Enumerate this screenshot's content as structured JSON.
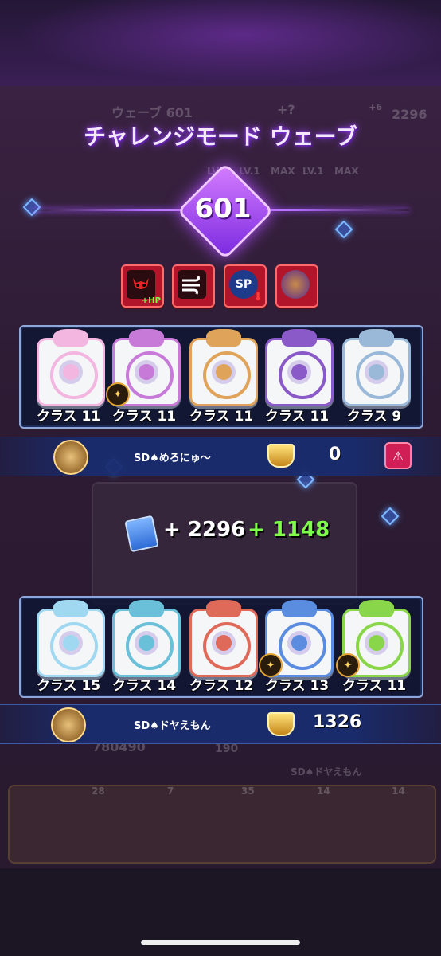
{
  "background": {
    "wave_header": "ウェーブ 601",
    "wave_bonus": "+?",
    "cards_corner": "2296",
    "cards_plus": "+6",
    "levels": [
      "LV.1",
      "LV.1",
      "MAX",
      "LV.1",
      "MAX"
    ],
    "board_score": "780490",
    "board_mid": "190",
    "bottom_player": "SD♠ドヤえもん",
    "bottom_levels": [
      "28",
      "7",
      "35",
      "14",
      "14"
    ]
  },
  "title": "チャレンジモード ウェーブ",
  "wave_number": "601",
  "modifiers": [
    {
      "icon": "devil-hp-icon",
      "label": "+HP"
    },
    {
      "icon": "wind-icon",
      "label": ""
    },
    {
      "icon": "sp-down-icon",
      "label": "SP"
    },
    {
      "icon": "boss-ring-icon",
      "label": ""
    }
  ],
  "opponent": {
    "dice": [
      {
        "icon": "infinity-dice-icon",
        "label": "クラス 11",
        "color": "#f2b6e0"
      },
      {
        "icon": "sword-dice-icon",
        "label": "クラス 11",
        "color": "#c77ad8"
      },
      {
        "icon": "clock-dice-icon",
        "label": "クラス 11",
        "color": "#e0a35a"
      },
      {
        "icon": "eclipse-dice-icon",
        "label": "クラス 11",
        "color": "#8a5ac8"
      },
      {
        "icon": "paper-dice-icon",
        "label": "クラス 9",
        "color": "#9ab8d8"
      }
    ],
    "name": "SD♠めろにゅ〜",
    "trophies": "0"
  },
  "reward": {
    "base": "+ 2296",
    "bonus": "+ 1148",
    "base_color": "#ffffff",
    "bonus_color": "#7dff4a"
  },
  "player": {
    "dice": [
      {
        "icon": "orbit-dice-icon",
        "label": "クラス 15",
        "color": "#9fd8f0"
      },
      {
        "icon": "tide-dice-icon",
        "label": "クラス 14",
        "color": "#6ac0d8"
      },
      {
        "icon": "target-dice-icon",
        "label": "クラス 12",
        "color": "#e06a5a"
      },
      {
        "icon": "moon-dice-icon",
        "label": "クラス 13",
        "color": "#5a8ce0"
      },
      {
        "icon": "lightning-dice-icon",
        "label": "クラス 11",
        "color": "#8ad64a"
      }
    ],
    "name": "SD♠ドヤえもん",
    "trophies": "1326"
  }
}
